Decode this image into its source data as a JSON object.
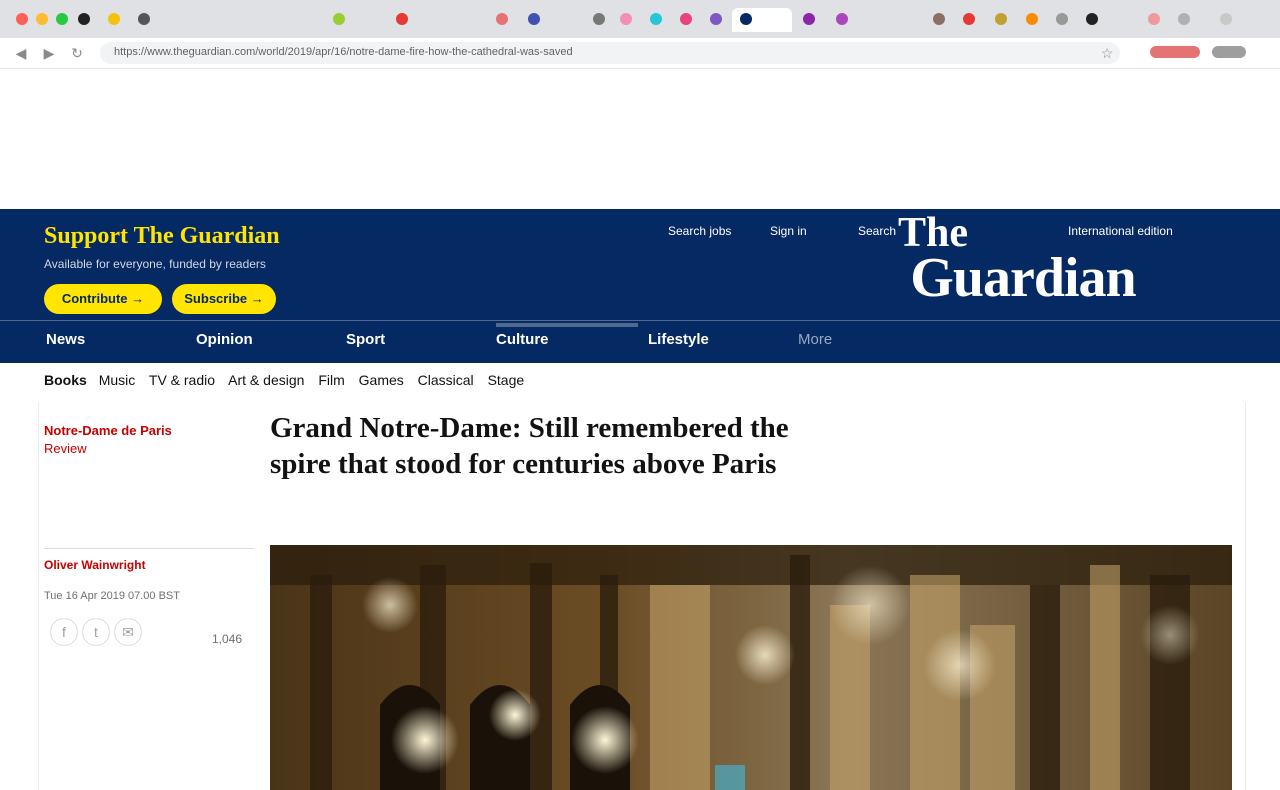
{
  "colors": {
    "guardian_blue": "#052962",
    "support_yellow": "#ffe500",
    "label_red": "#c70000"
  },
  "browser": {
    "address": "https://www.theguardian.com/world/2019/apr/16/notre-dame-fire-how-the-cathedral-was-saved",
    "back_icon": "back-arrow-icon",
    "forward_icon": "forward-arrow-icon",
    "reload_icon": "reload-icon"
  },
  "masthead": {
    "support_heading": "Support The Guardian",
    "support_sub": "Available for everyone, funded by readers",
    "contribute_label": "Contribute →",
    "subscribe_label": "Subscribe →",
    "links": [
      "Search jobs",
      "Sign in",
      "Search",
      "International edition"
    ],
    "logo_the": "The",
    "logo_name": "Guardian"
  },
  "nav": {
    "pillars": [
      "News",
      "Opinion",
      "Sport",
      "Culture",
      "Lifestyle",
      "More"
    ]
  },
  "subnav": {
    "first": "Books",
    "items": [
      "Music",
      "TV & radio",
      "Art & design",
      "Film",
      "Games",
      "Classical",
      "Stage"
    ]
  },
  "article": {
    "section": "Notre-Dame de Paris",
    "section_sub": "Review",
    "headline": "Grand Notre-Dame: Still remembered the spire that stood for centuries above Paris",
    "byline": "Oliver Wainwright",
    "date": "Tue 16 Apr 2019 07.00 BST",
    "comments": "1,046"
  }
}
